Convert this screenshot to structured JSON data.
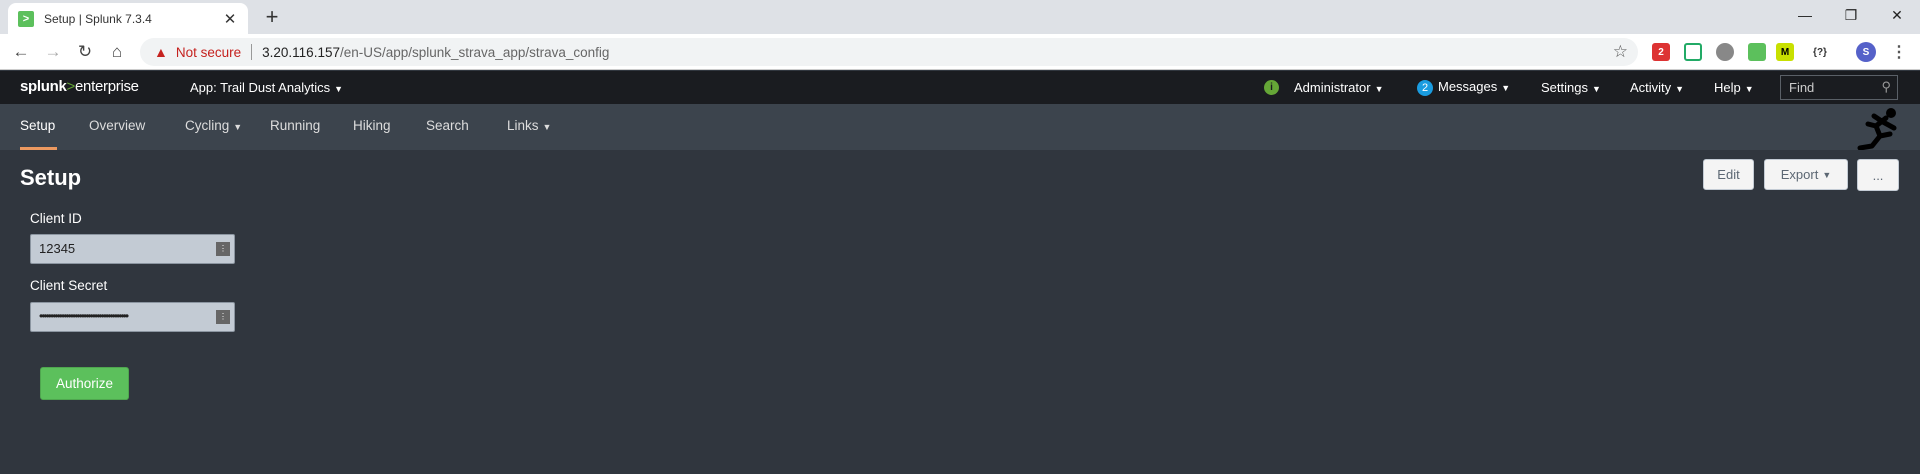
{
  "browser": {
    "tab_title": "Setup | Splunk 7.3.4",
    "favicon_glyph": ">",
    "close_glyph": "✕",
    "newtab_glyph": "+",
    "not_secure": "Not secure",
    "url_host": "3.20.116.157",
    "url_path": "/en-US/app/splunk_strava_app/strava_config",
    "profile_initial": "S",
    "ext_badge": "2",
    "ext_json": "{?}",
    "ext_m": "M"
  },
  "splunkbar": {
    "logo_brand": "splunk",
    "logo_gt": ">",
    "logo_product": "enterprise",
    "app_label": "App: Trail Dust Analytics",
    "user": "Administrator",
    "messages_count": "2",
    "messages": "Messages",
    "settings": "Settings",
    "activity": "Activity",
    "help": "Help",
    "find_placeholder": "Find"
  },
  "appbar": {
    "items": [
      "Setup",
      "Overview",
      "Cycling",
      "Running",
      "Hiking",
      "Search",
      "Links"
    ]
  },
  "page": {
    "title": "Setup",
    "edit": "Edit",
    "export": "Export",
    "more": "...",
    "client_id_label": "Client ID",
    "client_id_value": "12345",
    "client_secret_label": "Client Secret",
    "client_secret_value": "••••••••••••••••••••••••••••••••••••••••",
    "authorize": "Authorize"
  },
  "colors": {
    "accent_green": "#5cc05c",
    "active_tab_underline": "#ec9960",
    "background": "#30363e"
  }
}
